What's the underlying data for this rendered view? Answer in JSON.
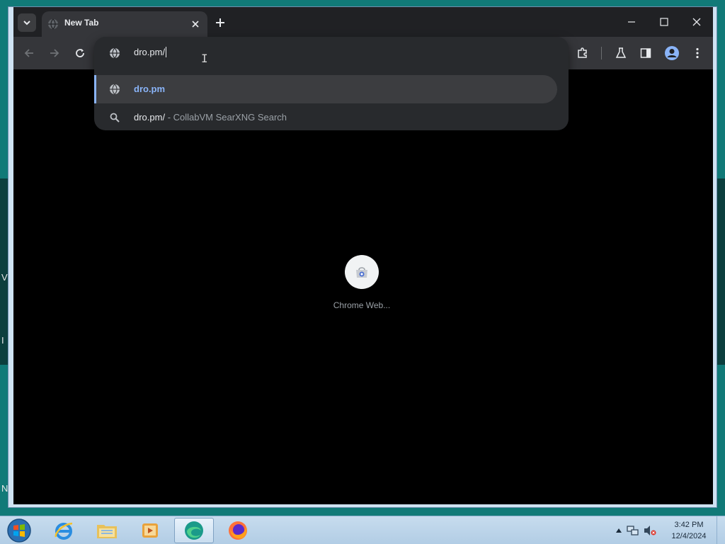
{
  "desktop": {
    "side_chars": [
      "V",
      "I",
      "N"
    ]
  },
  "tabstrip": {
    "tab_title": "New Tab"
  },
  "omnibox": {
    "input_value": "dro.pm/",
    "suggestions": [
      {
        "icon": "globe-icon",
        "text": "dro.pm",
        "desc": ""
      },
      {
        "icon": "search-icon",
        "text": "dro.pm/",
        "desc": " - CollabVM SearXNG Search"
      }
    ]
  },
  "shortcut": {
    "label": "Chrome Web..."
  },
  "taskbar": {
    "apps": [
      "internet-explorer",
      "file-explorer",
      "media-player",
      "edge",
      "firefox"
    ],
    "time": "3:42 PM",
    "date": "12/4/2024"
  },
  "colors": {
    "accent": "#8ab4f8",
    "toolbar": "#35363a",
    "tabstrip": "#202124",
    "dropdown": "#282a2d"
  }
}
